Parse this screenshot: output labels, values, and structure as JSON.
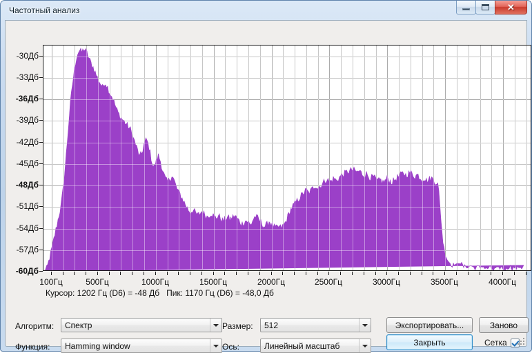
{
  "window": {
    "title": "Частотный анализ",
    "buttons": {
      "minimize": "minimize-icon",
      "maximize": "maximize-icon",
      "close": "✕"
    }
  },
  "status": {
    "text": "Курсор: 1202 Гц (D6) = -48 Дб   Пик: 1170 Гц (D6) = -48,0 Дб"
  },
  "controls": {
    "algorithm_label": "Алгоритм:",
    "algorithm_value": "Спектр",
    "function_label": "Функция:",
    "function_value": "Hamming window",
    "size_label": "Размер:",
    "size_value": "512",
    "axis_label": "Ось:",
    "axis_value": "Линейный масштаб",
    "export_button": "Экспортировать...",
    "redo_button": "Заново",
    "close_button": "Закрыть",
    "grid_checkbox_label": "Сетка",
    "grid_checkbox_checked": true
  },
  "colors": {
    "spectrum_fill": "#9B40C8",
    "spectrum_grid_overlay": "#B977DD",
    "plot_background": "#FFFFFF",
    "grid_minor": "#9D9D9D",
    "grid_major": "#6F6F6F",
    "window_chrome": "#C8DBEF",
    "client_background": "#F0EEEC",
    "default_button_border": "#2C8CC9"
  },
  "chart_data": {
    "type": "area",
    "title": "",
    "xlabel": "",
    "ylabel": "",
    "xunit": "Гц",
    "yunit": "Дб",
    "xlim": [
      30,
      4250
    ],
    "ylim": [
      -60,
      -28.5
    ],
    "grid": true,
    "legend": null,
    "y_ticks": [
      -30,
      -33,
      -36,
      -39,
      -42,
      -45,
      -48,
      -51,
      -54,
      -57,
      -60
    ],
    "y_tick_labels": [
      "-30Дб",
      "-33Дб",
      "-36Дб",
      "-39Дб",
      "-42Дб",
      "-45Дб",
      "-48Дб",
      "-51Дб",
      "-54Дб",
      "-57Дб",
      "-60Дб"
    ],
    "y_major_ticks": [
      -36,
      -48,
      -60
    ],
    "x_ticks": [
      100,
      500,
      1000,
      1500,
      2000,
      2500,
      3000,
      3500,
      4000
    ],
    "x_tick_labels": [
      "100Гц",
      "500Гц",
      "1000Гц",
      "1500Гц",
      "2000Гц",
      "2500Гц",
      "3000Гц",
      "3500Гц",
      "4000Гц"
    ],
    "x_minor_step": 100,
    "cursor": {
      "freq_hz": 1202,
      "note": "D6",
      "db": -48
    },
    "peak": {
      "freq_hz": 1170,
      "note": "D6",
      "db": -48.0
    },
    "series": [
      {
        "name": "Спектр",
        "color": "#9B40C8",
        "x": [
          40,
          60,
          80,
          100,
          120,
          140,
          160,
          180,
          200,
          220,
          240,
          260,
          280,
          300,
          320,
          340,
          360,
          380,
          400,
          420,
          440,
          460,
          480,
          500,
          520,
          540,
          560,
          580,
          600,
          620,
          640,
          660,
          680,
          700,
          720,
          740,
          760,
          780,
          800,
          820,
          840,
          860,
          880,
          900,
          920,
          940,
          960,
          980,
          1000,
          1020,
          1040,
          1060,
          1080,
          1100,
          1120,
          1140,
          1160,
          1180,
          1200,
          1220,
          1240,
          1260,
          1280,
          1300,
          1320,
          1340,
          1360,
          1380,
          1400,
          1420,
          1440,
          1460,
          1480,
          1500,
          1520,
          1540,
          1560,
          1580,
          1600,
          1620,
          1640,
          1660,
          1680,
          1700,
          1720,
          1740,
          1760,
          1780,
          1800,
          1820,
          1840,
          1860,
          1880,
          1900,
          1920,
          1940,
          1960,
          1980,
          2000,
          2020,
          2040,
          2060,
          2080,
          2100,
          2120,
          2140,
          2160,
          2180,
          2200,
          2220,
          2240,
          2260,
          2280,
          2300,
          2320,
          2340,
          2360,
          2380,
          2400,
          2420,
          2440,
          2460,
          2480,
          2500,
          2520,
          2540,
          2560,
          2580,
          2600,
          2620,
          2640,
          2660,
          2680,
          2700,
          2720,
          2740,
          2760,
          2780,
          2800,
          2820,
          2840,
          2860,
          2880,
          2900,
          2920,
          2940,
          2960,
          2980,
          3000,
          3020,
          3040,
          3060,
          3080,
          3100,
          3120,
          3140,
          3160,
          3180,
          3200,
          3220,
          3240,
          3260,
          3280,
          3300,
          3320,
          3340,
          3360,
          3380,
          3400,
          3420,
          3440,
          3460,
          3480,
          3500,
          3520,
          3540,
          3560,
          3580,
          3600,
          3620,
          3640,
          3660,
          3680,
          3700,
          3720,
          3740,
          3760,
          3780,
          3800,
          3820,
          3840,
          3860,
          3880,
          3900,
          3920,
          3940,
          3960,
          3980,
          4000,
          4020,
          4040,
          4060,
          4080,
          4100,
          4120,
          4140,
          4160,
          4180,
          4200,
          4220,
          4240
        ],
        "y": [
          -60.0,
          -59.6,
          -58.3,
          -57.0,
          -55.5,
          -54.0,
          -52.5,
          -51.0,
          -48.5,
          -45.0,
          -41.0,
          -37.0,
          -34.0,
          -31.6,
          -29.8,
          -29.2,
          -29.5,
          -29.0,
          -29.4,
          -30.2,
          -31.0,
          -31.6,
          -32.4,
          -33.2,
          -33.8,
          -34.4,
          -33.6,
          -34.2,
          -35.0,
          -35.6,
          -36.4,
          -37.4,
          -38.1,
          -38.6,
          -39.0,
          -39.4,
          -39.8,
          -40.2,
          -41.2,
          -42.0,
          -43.0,
          -44.0,
          -43.6,
          -42.2,
          -41.6,
          -42.6,
          -44.2,
          -45.6,
          -44.9,
          -43.8,
          -44.6,
          -46.0,
          -47.0,
          -47.6,
          -47.2,
          -46.6,
          -47.4,
          -48.4,
          -49.0,
          -49.6,
          -50.2,
          -50.8,
          -51.4,
          -51.8,
          -51.4,
          -51.8,
          -52.2,
          -52.0,
          -51.6,
          -52.0,
          -52.4,
          -52.2,
          -51.9,
          -52.3,
          -52.6,
          -52.2,
          -52.6,
          -53.0,
          -52.7,
          -52.4,
          -52.8,
          -52.5,
          -52.2,
          -52.6,
          -53.0,
          -53.4,
          -53.2,
          -52.9,
          -53.2,
          -53.6,
          -52.8,
          -52.3,
          -52.6,
          -53.0,
          -53.4,
          -53.8,
          -53.5,
          -53.0,
          -53.4,
          -53.8,
          -54.0,
          -53.8,
          -53.9,
          -53.7,
          -53.2,
          -52.4,
          -51.6,
          -51.0,
          -50.6,
          -50.2,
          -49.8,
          -49.4,
          -49.0,
          -48.7,
          -49.1,
          -48.8,
          -48.3,
          -48.0,
          -48.4,
          -48.1,
          -47.8,
          -47.4,
          -47.1,
          -47.6,
          -47.3,
          -47.0,
          -47.4,
          -47.0,
          -46.7,
          -46.5,
          -46.3,
          -46.1,
          -46.0,
          -45.8,
          -46.0,
          -46.2,
          -46.0,
          -46.4,
          -46.6,
          -46.4,
          -46.8,
          -47.0,
          -46.8,
          -47.2,
          -47.5,
          -47.2,
          -47.6,
          -47.4,
          -47.0,
          -47.4,
          -47.6,
          -47.3,
          -47.0,
          -46.8,
          -46.5,
          -46.3,
          -46.6,
          -46.4,
          -46.2,
          -46.5,
          -46.8,
          -46.5,
          -46.9,
          -47.2,
          -47.0,
          -47.4,
          -47.2,
          -47.0,
          -47.3,
          -47.6,
          -47.8,
          -52.0,
          -55.8,
          -57.6,
          -58.4,
          -58.8,
          -59.2,
          -58.9,
          -59.2,
          -58.6,
          -58.9,
          -59.4,
          -59.2,
          -59.5,
          -59.1,
          -59.4,
          -59.6,
          -59.3,
          -59.5,
          -59.2,
          -59.5,
          -59.7,
          -59.4,
          -59.6,
          -59.8,
          -59.5,
          -59.7,
          -59.4,
          -59.6,
          -59.8,
          -59.5,
          -59.3,
          -59.6,
          -59.4,
          -59.6,
          -59.3,
          -59.5,
          -59.2
        ]
      }
    ]
  }
}
